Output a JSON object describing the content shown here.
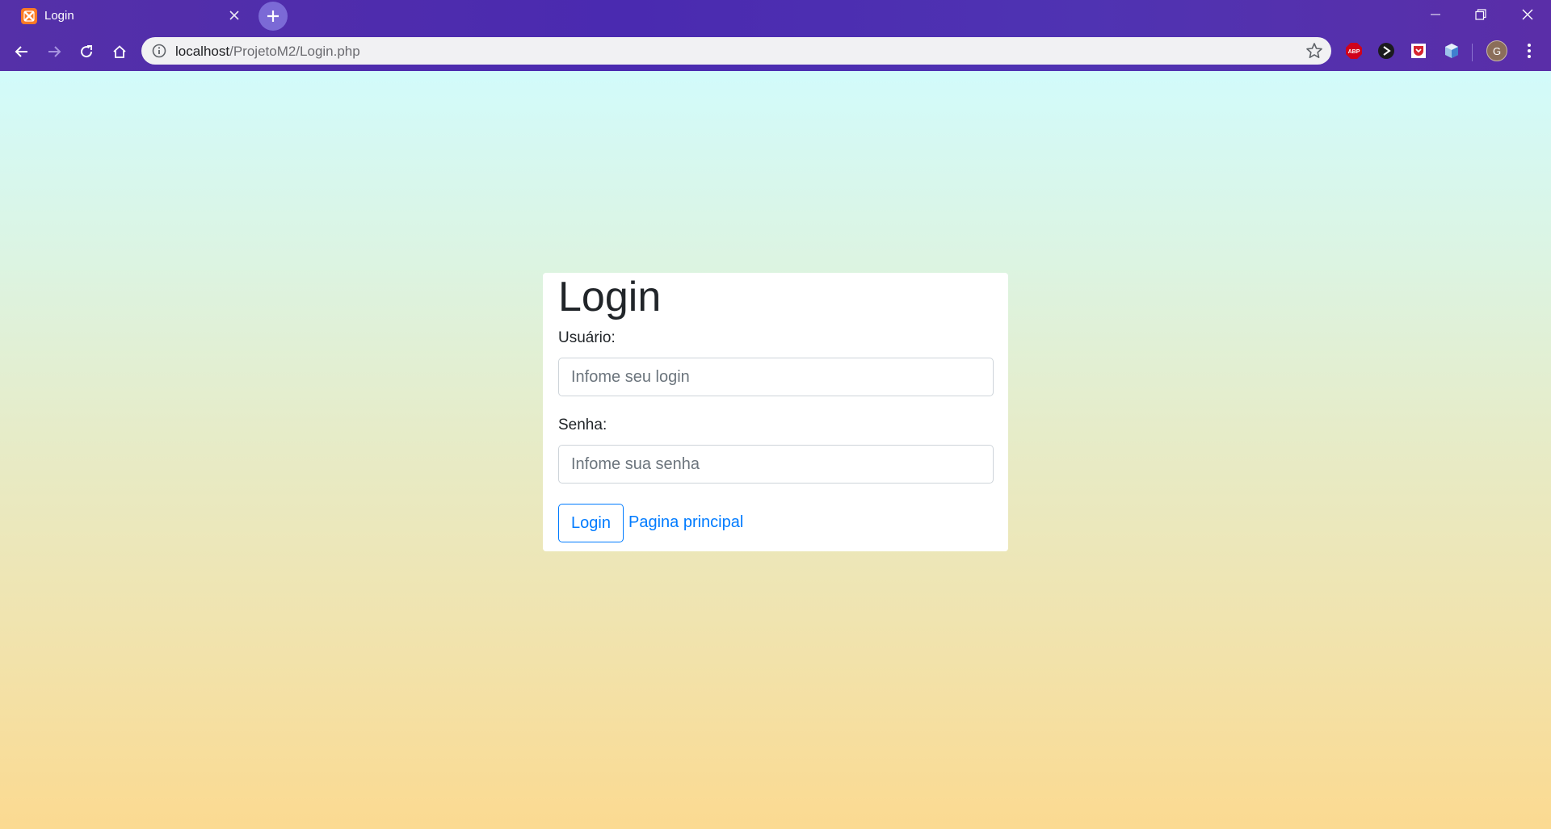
{
  "browser": {
    "tab_title": "Login",
    "url_host": "localhost",
    "url_path": "/ProjetoM2/Login.php",
    "profile_initial": "G",
    "extensions": [
      "adblock-plus-icon",
      "dark-mode-icon",
      "pocket-icon",
      "cube-extension-icon"
    ],
    "colors": {
      "chrome_gradient": [
        "#5530a8",
        "#4f33b2"
      ],
      "omnibox": "#f1f1f3"
    }
  },
  "page": {
    "title": "Login",
    "username_label": "Usuário:",
    "username_placeholder": "Infome seu login",
    "username_value": "",
    "password_label": "Senha:",
    "password_placeholder": "Infome sua senha",
    "password_value": "",
    "login_button": "Login",
    "home_link": "Pagina principal",
    "colors": {
      "accent": "#007bff",
      "bg_top": "#d2fbfb",
      "bg_bottom": "#fbda91"
    }
  }
}
